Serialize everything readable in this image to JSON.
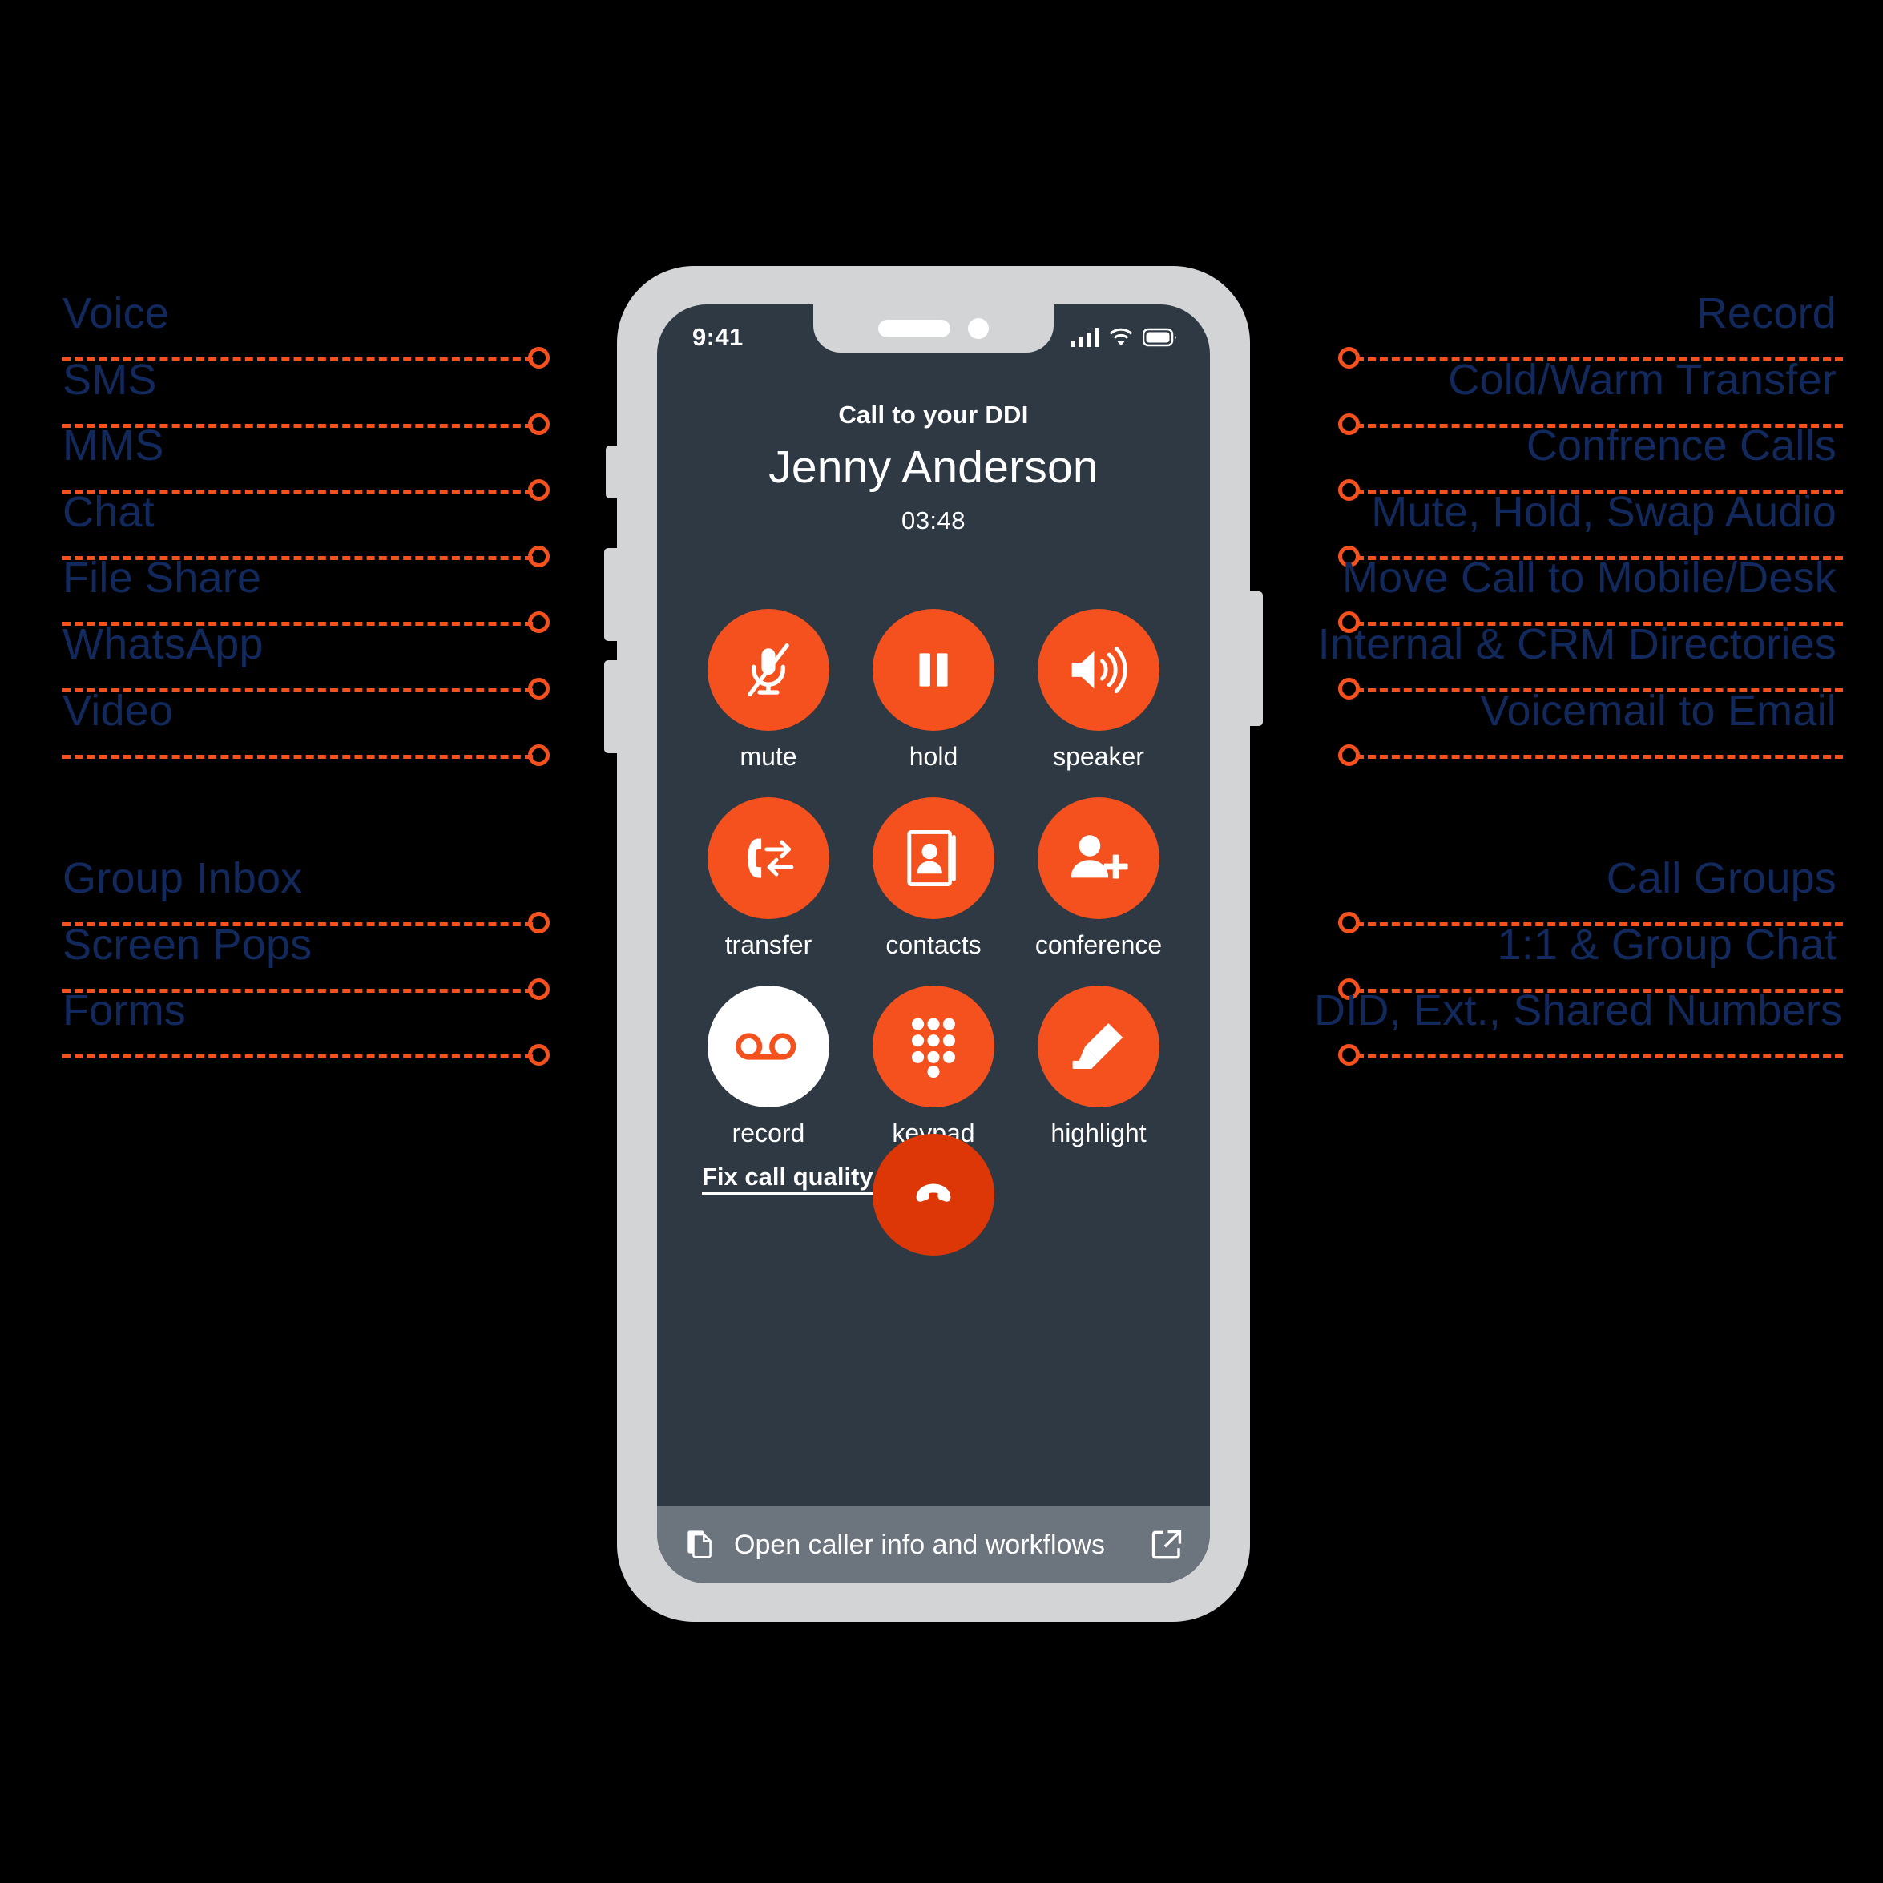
{
  "accent": {
    "orange": "#f4511e",
    "navy": "#12295e",
    "screen_bg": "#2e3944",
    "end_call": "#dd3707",
    "frame": "#d2d4d6",
    "workbar": "#6c747e"
  },
  "annotations": {
    "left": [
      {
        "label": "Voice"
      },
      {
        "label": "SMS"
      },
      {
        "label": "MMS"
      },
      {
        "label": "Chat"
      },
      {
        "label": "File Share"
      },
      {
        "label": "WhatsApp"
      },
      {
        "label": "Video"
      },
      {
        "label": "Group Inbox"
      },
      {
        "label": "Screen Pops"
      },
      {
        "label": "Forms"
      }
    ],
    "right": [
      {
        "label": "Record"
      },
      {
        "label": "Cold/Warm Transfer"
      },
      {
        "label": "Confrence Calls"
      },
      {
        "label": "Mute, Hold, Swap Audio"
      },
      {
        "label": "Move Call to Mobile/Desk"
      },
      {
        "label": "Internal & CRM Directories"
      },
      {
        "label": "Voicemail to Email"
      },
      {
        "label": "Call Groups"
      },
      {
        "label": "1:1 & Group Chat"
      },
      {
        "label": "DID, Ext., Shared Numbers"
      }
    ]
  },
  "phone": {
    "status": {
      "time": "9:41",
      "cellular_icon": "signal-bars-icon",
      "wifi_icon": "wifi-icon",
      "battery_icon": "battery-icon"
    },
    "call": {
      "subtitle": "Call to your DDI",
      "name": "Jenny Anderson",
      "timer": "03:48"
    },
    "buttons": [
      {
        "label": "mute",
        "icon": "microphone-muted-icon",
        "active": false
      },
      {
        "label": "hold",
        "icon": "pause-icon",
        "active": false
      },
      {
        "label": "speaker",
        "icon": "speaker-loud-icon",
        "active": false
      },
      {
        "label": "transfer",
        "icon": "call-transfer-icon",
        "active": false
      },
      {
        "label": "contacts",
        "icon": "contact-card-icon",
        "active": false
      },
      {
        "label": "conference",
        "icon": "add-person-icon",
        "active": false
      },
      {
        "label": "record",
        "icon": "voicemail-record-icon",
        "active": true
      },
      {
        "label": "keypad",
        "icon": "dialpad-icon",
        "active": false
      },
      {
        "label": "highlight",
        "icon": "highlighter-pen-icon",
        "active": false
      }
    ],
    "fix_call_quality": "Fix call quality",
    "end_call_icon": "end-call-handset-icon",
    "workbar": {
      "text": "Open caller info and workflows",
      "left_icon": "document-copy-icon",
      "right_icon": "external-link-icon"
    }
  }
}
